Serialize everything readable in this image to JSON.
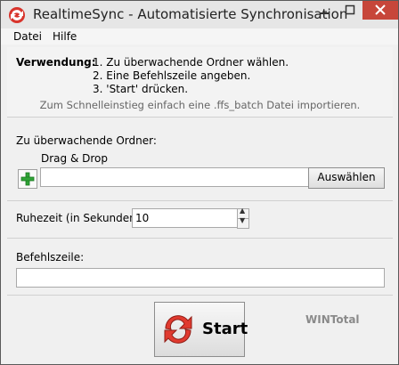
{
  "window": {
    "title": "RealtimeSync - Automatisierte Synchronisation",
    "colors": {
      "close_button": "#c7463a",
      "frame": "#5a5a5a"
    }
  },
  "menu": {
    "items": [
      "Datei",
      "Hilfe"
    ]
  },
  "help": {
    "label": "Verwendung:",
    "steps": [
      "1. Zu überwachende Ordner wählen.",
      "2. Eine Befehlszeile angeben.",
      "3. 'Start' drücken."
    ],
    "hint": "Zum Schnelleinstieg einfach eine .ffs_batch Datei importieren."
  },
  "folders": {
    "label": "Zu überwachende Ordner:",
    "drag_drop": "Drag & Drop",
    "input_value": "",
    "select_button": "Auswählen",
    "add_icon": "plus-icon"
  },
  "delay": {
    "label": "Ruhezeit (in Sekunden):",
    "value": "10"
  },
  "command": {
    "label": "Befehlszeile:",
    "value": ""
  },
  "start": {
    "label": "Start",
    "icon": "sync-arrows-icon"
  },
  "watermark": {
    "text": "WINTotal"
  }
}
